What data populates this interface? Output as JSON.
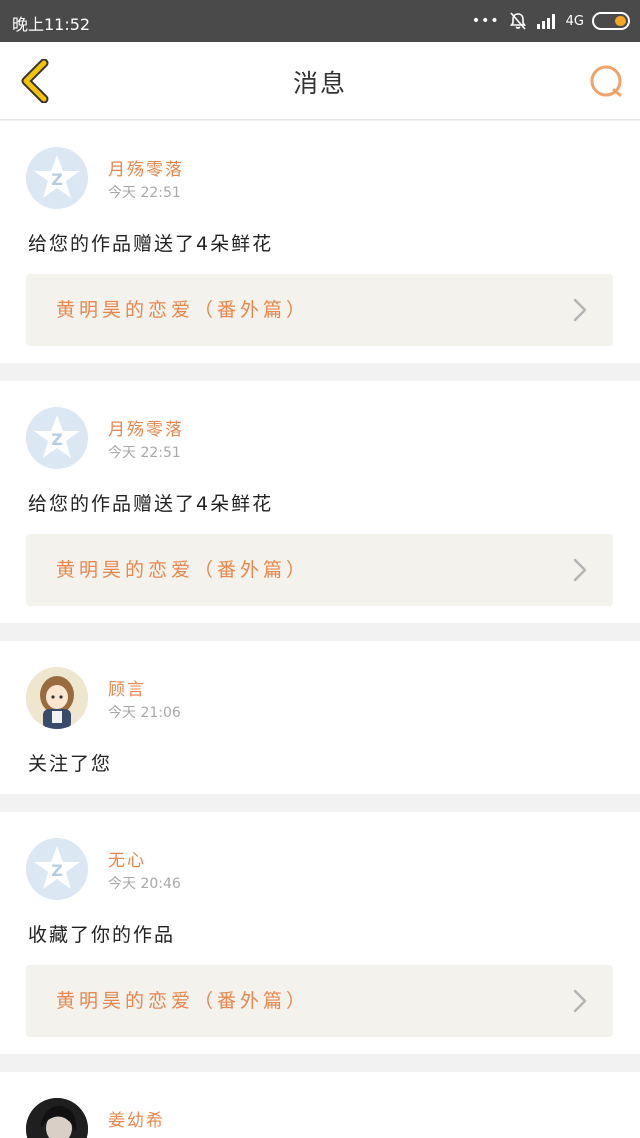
{
  "status_bar": {
    "time": "晚上11:52",
    "dots": "•••",
    "network": "4G"
  },
  "nav": {
    "title": "消息",
    "back_icon": "chevron-left-icon",
    "search_icon": "search-icon"
  },
  "colors": {
    "accent": "#e8874d",
    "back_arrow": "#f5c400",
    "card_link_bg": "#f3f2ec"
  },
  "messages": [
    {
      "username": "月殇零落",
      "time": "今天 22:51",
      "text": "给您的作品赠送了4朵鲜花",
      "work_title": "黄明昊的恋爱（番外篇）",
      "avatar": "default-qq-avatar"
    },
    {
      "username": "月殇零落",
      "time": "今天 22:51",
      "text": "给您的作品赠送了4朵鲜花",
      "work_title": "黄明昊的恋爱（番外篇）",
      "avatar": "default-qq-avatar"
    },
    {
      "username": "顾言",
      "time": "今天 21:06",
      "text": "关注了您",
      "avatar": "anime-girl-avatar"
    },
    {
      "username": "无心",
      "time": "今天 20:46",
      "text": "收藏了你的作品",
      "work_title": "黄明昊的恋爱（番外篇）",
      "avatar": "default-qq-avatar"
    },
    {
      "username": "姜幼希",
      "avatar": "photo-avatar"
    }
  ]
}
